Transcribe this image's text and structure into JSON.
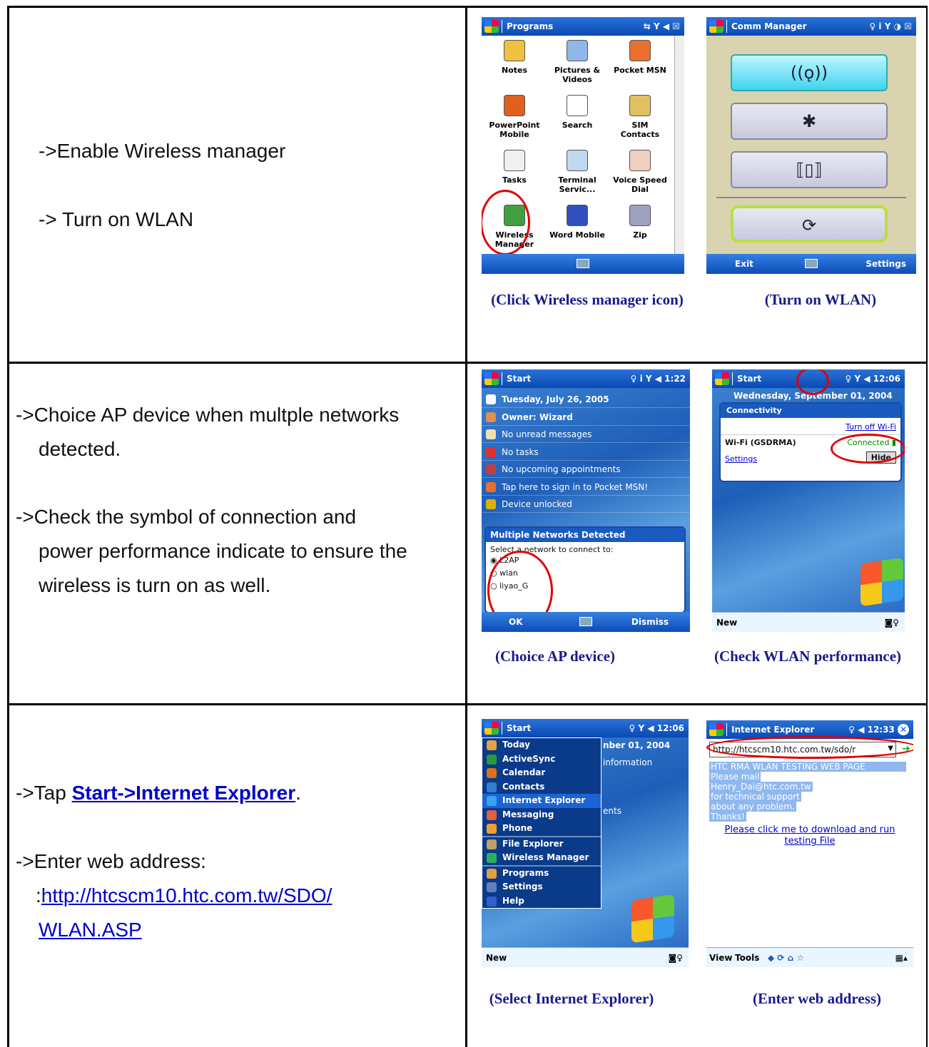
{
  "rows": [
    {
      "lines": [
        "->Enable Wireless manager",
        "-> Turn on WLAN"
      ],
      "captions": [
        "(Click Wireless manager icon)",
        "(Turn on WLAN)"
      ]
    },
    {
      "lines": [
        "->Choice AP device when multple networks",
        "detected.",
        "->Check the symbol of connection and",
        "power performance indicate to ensure the",
        "wireless is turn on as well."
      ],
      "captions": [
        "(Choice AP device)",
        "(Check WLAN performance)"
      ]
    },
    {
      "line1_prefix": "->Tap ",
      "line1_link1": "Start",
      "line1_link2": "->Internet Explorer",
      "line1_suffix": ".",
      "line2": "->Enter web address:",
      "line3_prefix": ":",
      "url_part1": "http://htcscm10.htc.com.tw/SDO/",
      "url_part2": "WLAN.ASP",
      "captions": [
        "(Select Internet Explorer)",
        "(Enter web address)"
      ]
    }
  ],
  "s1": {
    "title": "Programs",
    "icons": [
      {
        "label": "Notes",
        "icon": "notepad-icon",
        "color": "#f0c040"
      },
      {
        "label": "Pictures & Videos",
        "icon": "pictures-icon",
        "color": "#8fb8e8"
      },
      {
        "label": "Pocket MSN",
        "icon": "butterfly-icon",
        "color": "#e87030"
      },
      {
        "label": "PowerPoint Mobile",
        "icon": "powerpoint-icon",
        "color": "#e06020"
      },
      {
        "label": "Search",
        "icon": "magnifier-icon",
        "color": "#ffffff"
      },
      {
        "label": "SIM Contacts",
        "icon": "sim-card-icon",
        "color": "#e0c060"
      },
      {
        "label": "Tasks",
        "icon": "clipboard-icon",
        "color": "#f0f0f0"
      },
      {
        "label": "Terminal Servic...",
        "icon": "terminal-icon",
        "color": "#c0d8f0"
      },
      {
        "label": "Voice Speed Dial",
        "icon": "voice-dial-icon",
        "color": "#f0d0c0"
      },
      {
        "label": "Wireless Manager",
        "icon": "wireless-manager-icon",
        "color": "#40a040"
      },
      {
        "label": "Word Mobile",
        "icon": "word-icon",
        "color": "#3050c0"
      },
      {
        "label": "Zip",
        "icon": "zip-icon",
        "color": "#a0a0c0"
      }
    ]
  },
  "s2": {
    "title": "Comm Manager",
    "exit": "Exit",
    "settings": "Settings",
    "buttons": [
      "((ǫ))",
      "✱",
      "⟦▯⟧",
      "⟳"
    ]
  },
  "s3": {
    "title": "Start",
    "time": "1:22",
    "rows": [
      {
        "text": "Tuesday, July 26, 2005",
        "color": "#fff"
      },
      {
        "text": "Owner: Wizard",
        "color": "#e09050"
      },
      {
        "text": "No unread messages",
        "color": "#f0e0b0"
      },
      {
        "text": "No tasks",
        "color": "#e03030"
      },
      {
        "text": "No upcoming appointments",
        "color": "#c04040"
      },
      {
        "text": "Tap here to sign in to Pocket MSN!",
        "color": "#e87030"
      },
      {
        "text": "Device unlocked",
        "color": "#e0b000"
      }
    ],
    "dialog_title": "Multiple Networks Detected",
    "dialog_prompt": "Select a network to connect to:",
    "networks": [
      "L2AP",
      "wlan",
      "liyao_G"
    ],
    "ok": "OK",
    "dismiss": "Dismiss"
  },
  "s4": {
    "title": "Start",
    "time": "12:06",
    "date": "Wednesday, September 01, 2004",
    "popup_title": "Connectivity",
    "turn_off": "Turn off Wi-Fi",
    "network": "Wi-Fi (GSDRMA)",
    "status": "Connected",
    "settings": "Settings",
    "hide": "Hide",
    "new": "New"
  },
  "s5": {
    "title": "Start",
    "time": "12:06",
    "date_frag": "nber 01, 2004",
    "info_frag": "information",
    "ents_frag": "ents",
    "menu": [
      "Today",
      "ActiveSync",
      "Calendar",
      "Contacts",
      "Internet Explorer",
      "Messaging",
      "Phone",
      "File Explorer",
      "Wireless Manager",
      "Programs",
      "Settings",
      "Help"
    ],
    "new": "New"
  },
  "s6": {
    "title": "Internet Explorer",
    "time": "12:33",
    "address": "http://htcscm10.htc.com.tw/sdo/r",
    "page_lines": [
      "HTC RMA WLAN TESTING WEB PAGE",
      "Please mail",
      "Henry_Dai@htc.com.tw",
      "for technical support",
      "about any problem.",
      "Thanks!"
    ],
    "link": "Please click me to download and run testing File",
    "view": "View",
    "tools": "Tools"
  }
}
